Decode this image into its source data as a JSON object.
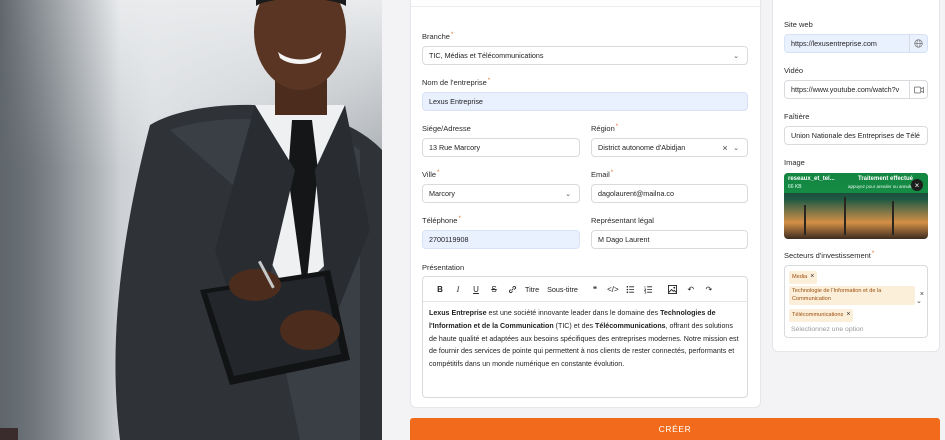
{
  "form": {
    "branche": {
      "label": "Branche",
      "value": "TIC, Médias et Télécommunications"
    },
    "nom": {
      "label": "Nom de l'entreprise",
      "value": "Lexus Entreprise"
    },
    "siege": {
      "label": "Siége/Adresse",
      "value": "13 Rue Marcory"
    },
    "region": {
      "label": "Région",
      "value": "District autonome d'Abidjan"
    },
    "ville": {
      "label": "Ville",
      "value": "Marcory"
    },
    "email": {
      "label": "Email",
      "value": "dagolaurent@mailna.co"
    },
    "telephone": {
      "label": "Téléphone",
      "value": "2700119908"
    },
    "representant": {
      "label": "Représentant légal",
      "value": "M Dago Laurent"
    },
    "presentation": {
      "label": "Présentation",
      "toolbar": {
        "titre": "Titre",
        "sous_titre": "Sous-titre"
      },
      "paragraph": {
        "b1": "Lexus Entreprise",
        "t1": " est une société innovante leader dans le domaine des ",
        "b2": "Technologies de l'Information et de la Communication",
        "t2": " (TIC) et des ",
        "b3": "Télécommunications",
        "t3": ", offrant des solutions de haute qualité et adaptées aux besoins spécifiques des entreprises modernes. Notre mission est de fournir des services de pointe qui permettent à nos clients de rester connectés, performants et compétitifs dans un monde numérique en constante évolution."
      }
    },
    "required_mark": "*"
  },
  "side": {
    "site_web": {
      "label": "Site web",
      "value": "https://lexusentreprise.com",
      "icon": "globe-icon"
    },
    "video": {
      "label": "Vidéo",
      "value": "https://www.youtube.com/watch?v",
      "icon": "video-icon"
    },
    "faitiere": {
      "label": "Faîtière",
      "value": "Union Nationale des Entreprises de Télé"
    },
    "image": {
      "label": "Image",
      "file_name": "reseaux_et_tel...",
      "file_size": "66 KB",
      "status": "Traitement effectué",
      "hint": "appuyez pour annuler ou annuler"
    },
    "secteurs": {
      "label": "Secteurs d'investissement",
      "tags": [
        "Media",
        "Technologie de l'Information et de la Communication",
        "Télécommunications"
      ],
      "placeholder": "Sélectionnez une option"
    }
  },
  "actions": {
    "create_label": "CRÉER"
  },
  "colors": {
    "accent": "#f26a1b",
    "filled_field": "#e9f0fe",
    "tag_bg": "#fcefd9"
  }
}
